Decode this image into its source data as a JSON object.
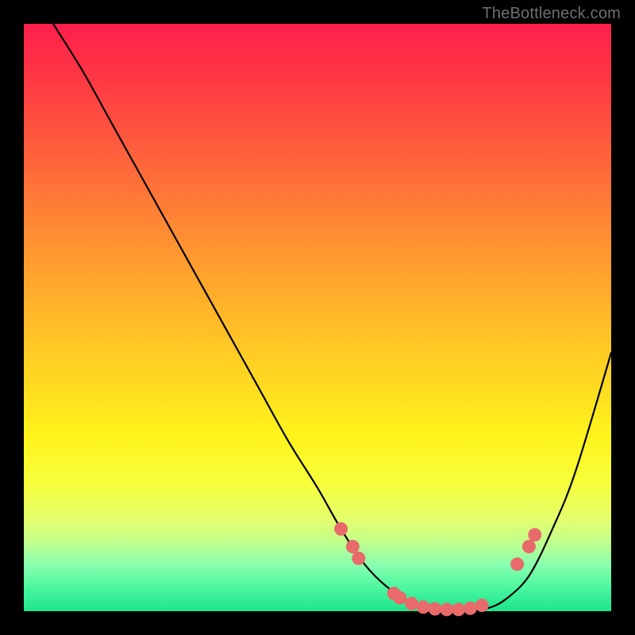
{
  "watermark": "TheBottleneck.com",
  "chart_data": {
    "type": "line",
    "title": "",
    "xlabel": "",
    "ylabel": "",
    "xlim": [
      0,
      100
    ],
    "ylim": [
      0,
      100
    ],
    "series": [
      {
        "name": "curve",
        "x": [
          5,
          10,
          15,
          20,
          25,
          30,
          35,
          40,
          45,
          50,
          54,
          58,
          62,
          66,
          70,
          73,
          76,
          79,
          82,
          86,
          90,
          94,
          100
        ],
        "y": [
          100,
          92,
          83,
          74,
          65,
          56,
          47,
          38,
          29,
          21,
          14,
          8,
          4,
          1.5,
          0.5,
          0,
          0,
          0.5,
          2,
          6,
          14,
          24,
          44
        ]
      }
    ],
    "markers": [
      {
        "x": 54,
        "y": 14
      },
      {
        "x": 56,
        "y": 11
      },
      {
        "x": 57,
        "y": 9
      },
      {
        "x": 63,
        "y": 3
      },
      {
        "x": 64,
        "y": 2.3
      },
      {
        "x": 66,
        "y": 1.3
      },
      {
        "x": 68,
        "y": 0.7
      },
      {
        "x": 70,
        "y": 0.4
      },
      {
        "x": 72,
        "y": 0.3
      },
      {
        "x": 74,
        "y": 0.3
      },
      {
        "x": 76,
        "y": 0.5
      },
      {
        "x": 78,
        "y": 1
      },
      {
        "x": 84,
        "y": 8
      },
      {
        "x": 86,
        "y": 11
      },
      {
        "x": 87,
        "y": 13
      }
    ],
    "marker_color": "#e86a6a",
    "curve_color": "#000000"
  }
}
